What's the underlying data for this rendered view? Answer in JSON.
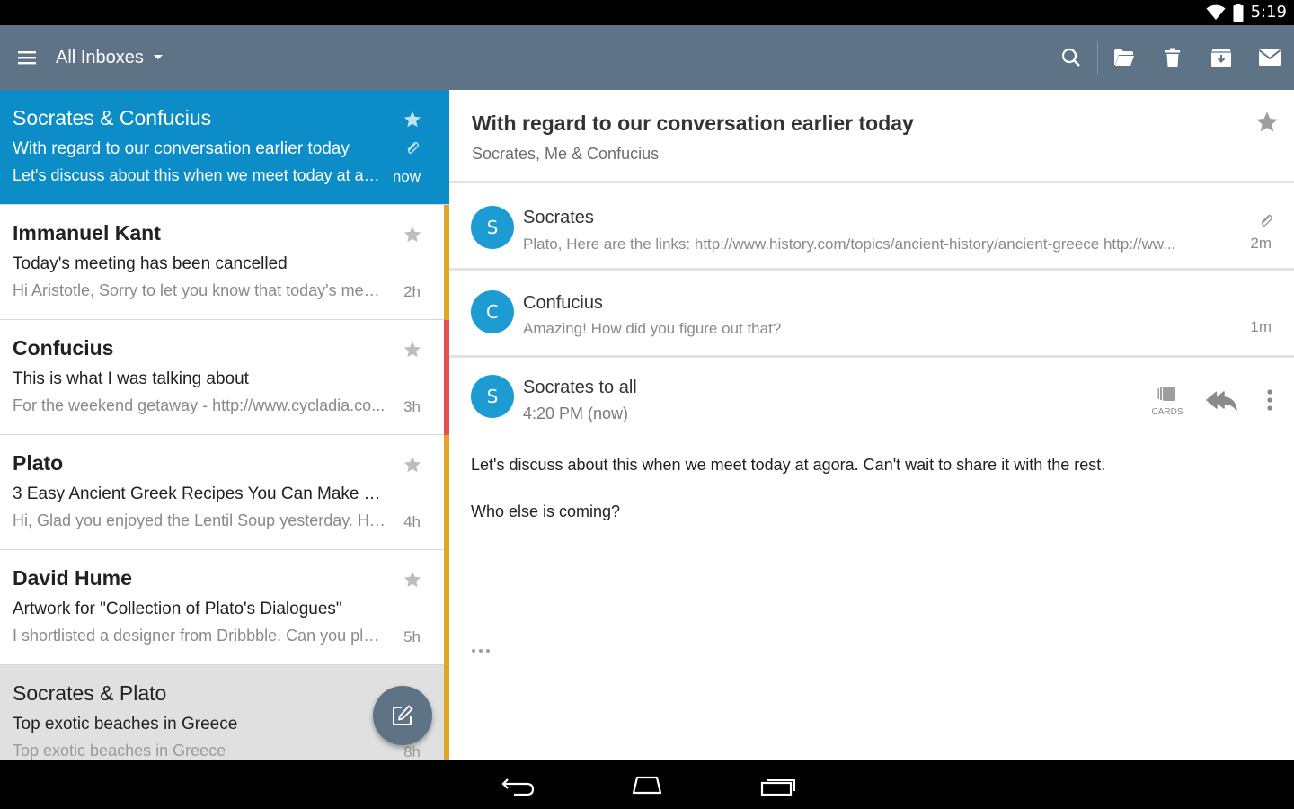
{
  "status_bar": {
    "time": "5:19"
  },
  "toolbar": {
    "inbox_label": "All Inboxes",
    "icons": [
      "search-icon",
      "folder-icon",
      "trash-icon",
      "archive-icon",
      "mail-icon"
    ]
  },
  "list": {
    "items": [
      {
        "from": "Socrates & Confucius",
        "subject": "With regard to our conversation earlier today",
        "snippet": "Let's discuss about this when we meet today at ag...",
        "time": "now",
        "state": "selected",
        "stripe_color": ""
      },
      {
        "from": "Immanuel Kant",
        "subject": "Today's meeting has been cancelled",
        "snippet": "Hi Aristotle, Sorry to let you know that today's mee...",
        "time": "2h",
        "state": "unread",
        "stripe_color": "#e0a52a"
      },
      {
        "from": "Confucius",
        "subject": "This is what I was talking about",
        "snippet": "For the weekend getaway - http://www.cycladia.co...",
        "time": "3h",
        "state": "unread",
        "stripe_color": "#e35252"
      },
      {
        "from": "Plato",
        "subject": "3 Easy Ancient Greek Recipes You Can Make T...",
        "snippet": "Hi, Glad you enjoyed the Lentil Soup yesterday. He...",
        "time": "4h",
        "state": "unread",
        "stripe_color": "#e0a52a"
      },
      {
        "from": "David Hume",
        "subject": "Artwork for \"Collection of Plato's Dialogues\"",
        "snippet": "I shortlisted a designer from Dribbble. Can you ple...",
        "time": "5h",
        "state": "unread",
        "stripe_color": "#e0a52a"
      },
      {
        "from": "Socrates & Plato",
        "subject": "Top exotic beaches in Greece",
        "snippet": "Top exotic beaches in Greece",
        "time": "8h",
        "state": "read",
        "stripe_color": "#e0a52a"
      }
    ]
  },
  "thread": {
    "subject": "With regard to our conversation earlier today",
    "participants": "Socrates, Me & Confucius",
    "messages": [
      {
        "initial": "S",
        "sender": "Socrates",
        "preview": "Plato, Here are the links: http://www.history.com/topics/ancient-history/ancient-greece http://ww...",
        "time": "2m"
      },
      {
        "initial": "C",
        "sender": "Confucius",
        "preview": "Amazing! How did you figure out that?",
        "time": "1m"
      }
    ],
    "open_message": {
      "initial": "S",
      "sender": "Socrates to all",
      "sent": "4:20 PM (now)",
      "cards_label": "CARDS",
      "body": [
        "Let's discuss about this when we meet today at agora. Can't wait to share it with the rest.",
        "Who else is coming?"
      ]
    }
  },
  "colors": {
    "toolbar": "#5f7387",
    "selected": "#0d8dc8",
    "avatar": "#1d9bd3",
    "stripe_orange": "#e0a52a",
    "stripe_red": "#e35252"
  }
}
